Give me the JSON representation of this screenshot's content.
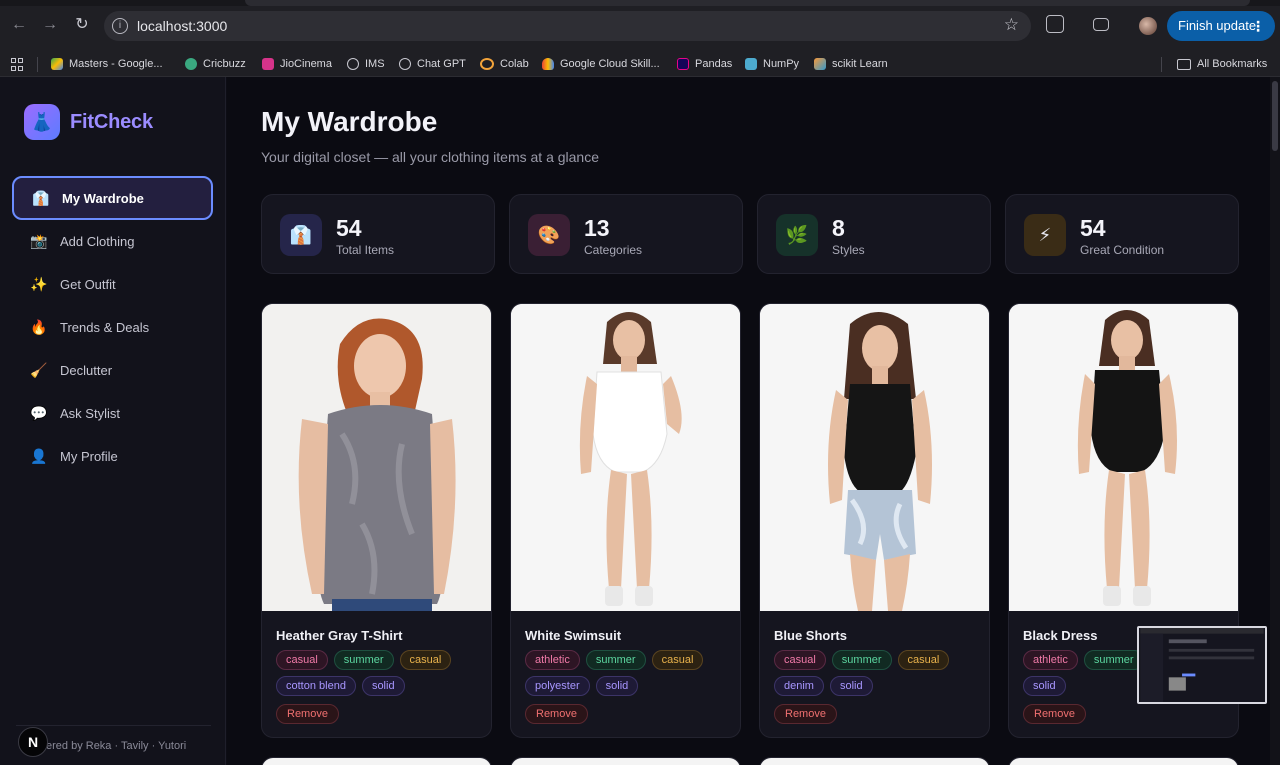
{
  "browser": {
    "url": "localhost:3000",
    "finish_update": "Finish update",
    "bookmarks": [
      "Masters - Google...",
      "Cricbuzz",
      "JioCinema",
      "IMS",
      "Chat GPT",
      "Colab",
      "Google Cloud Skill...",
      "Pandas",
      "NumPy",
      "scikit Learn"
    ],
    "all_bookmarks": "All Bookmarks"
  },
  "sidebar": {
    "brand": "FitCheck",
    "items": [
      {
        "label": "My Wardrobe",
        "icon": "👔"
      },
      {
        "label": "Add Clothing",
        "icon": "📸"
      },
      {
        "label": "Get Outfit",
        "icon": "✨"
      },
      {
        "label": "Trends & Deals",
        "icon": "🔥"
      },
      {
        "label": "Declutter",
        "icon": "🧹"
      },
      {
        "label": "Ask Stylist",
        "icon": "💬"
      },
      {
        "label": "My Profile",
        "icon": "👤"
      }
    ],
    "footer": "ered by Reka · Tavily · Yutori",
    "n_badge": "N"
  },
  "main": {
    "title": "My Wardrobe",
    "subtitle": "Your digital closet — all your clothing items at a glance",
    "stats": [
      {
        "value": "54",
        "label": "Total Items",
        "icon": "👔"
      },
      {
        "value": "13",
        "label": "Categories",
        "icon": "🎨"
      },
      {
        "value": "8",
        "label": "Styles",
        "icon": "🌿"
      },
      {
        "value": "54",
        "label": "Great Condition",
        "icon": "⚡"
      }
    ],
    "remove_label": "Remove",
    "items": [
      {
        "name": "Heather Gray T-Shirt",
        "tags": [
          "casual",
          "summer",
          "casual",
          "cotton blend",
          "solid"
        ]
      },
      {
        "name": "White Swimsuit",
        "tags": [
          "athletic",
          "summer",
          "casual",
          "polyester",
          "solid"
        ]
      },
      {
        "name": "Blue Shorts",
        "tags": [
          "casual",
          "summer",
          "casual",
          "denim",
          "solid"
        ]
      },
      {
        "name": "Black Dress",
        "tags": [
          "athletic",
          "summer",
          "spandex",
          "solid"
        ]
      }
    ]
  },
  "colors": {
    "accent": "#6b8cff",
    "brand": "#9b8cff",
    "background": "#0b0b12",
    "finish_button": "#0b5fa8"
  }
}
